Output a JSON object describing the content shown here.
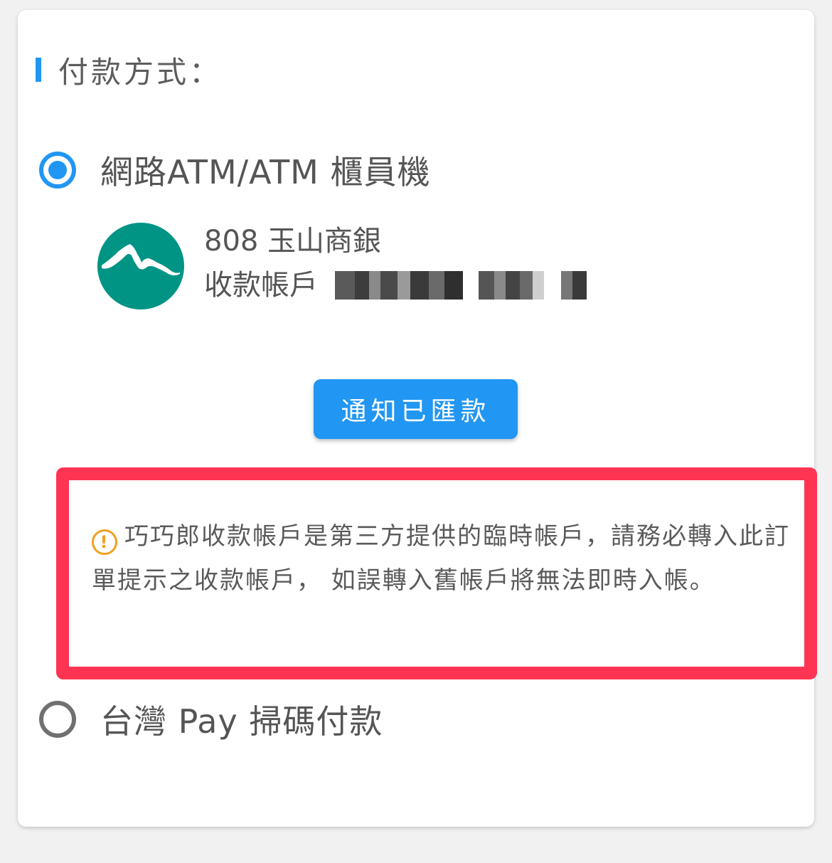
{
  "section_title": "付款方式：",
  "payment_options": [
    {
      "label": "網路ATM/ATM 櫃員機",
      "selected": true
    },
    {
      "label": "台灣 Pay 掃碼付款",
      "selected": false
    }
  ],
  "bank": {
    "name": "808 玉山商銀",
    "account_label": "收款帳戶",
    "logo_icon": "mountain-logo-icon"
  },
  "notify_button": "通知已匯款",
  "notice": {
    "icon": "warning-icon",
    "text": "巧巧郎收款帳戶是第三方提供的臨時帳戶，請務必轉入此訂單提示之收款帳戶， 如誤轉入舊帳戶將無法即時入帳。"
  },
  "colors": {
    "accent": "#2196f3",
    "notice_border": "#ff3352",
    "bank_logo": "#009485",
    "warning": "#f0a020"
  }
}
